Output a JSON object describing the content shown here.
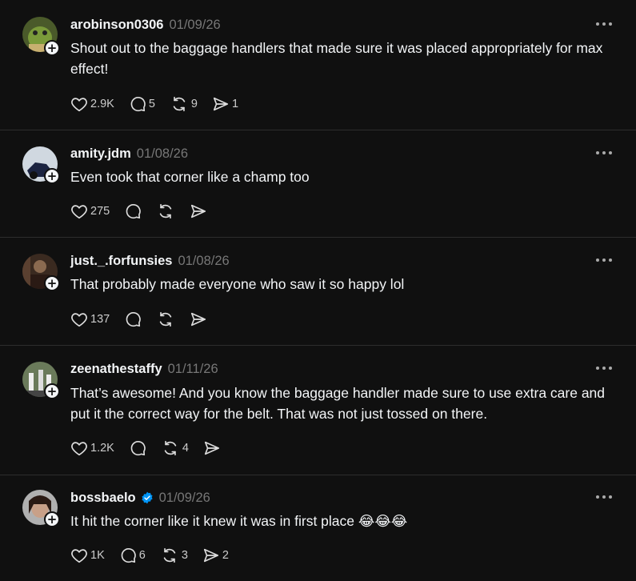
{
  "posts": [
    {
      "username": "arobinson0306",
      "date": "01/09/26",
      "verified": false,
      "text": "Shout out to the baggage handlers that made sure it was placed appropriately for max effect!",
      "likes": "2.9K",
      "replies": "5",
      "reposts": "9",
      "shares": "1"
    },
    {
      "username": "amity.jdm",
      "date": "01/08/26",
      "verified": false,
      "text": "Even took that corner like a champ too",
      "likes": "275",
      "replies": "",
      "reposts": "",
      "shares": ""
    },
    {
      "username": "just._.forfunsies",
      "date": "01/08/26",
      "verified": false,
      "text": "That probably made everyone who saw it so happy lol",
      "likes": "137",
      "replies": "",
      "reposts": "",
      "shares": ""
    },
    {
      "username": "zeenathestaffy",
      "date": "01/11/26",
      "verified": false,
      "text": "That’s awesome! And you know the baggage handler made sure to use extra care and put it the correct way for the belt. That was not just tossed on there.",
      "likes": "1.2K",
      "replies": "",
      "reposts": "4",
      "shares": ""
    },
    {
      "username": "bossbaelo",
      "date": "01/09/26",
      "verified": true,
      "text": "It hit the corner like it knew it was in first place",
      "emoji": "😂😂😂",
      "likes": "1K",
      "replies": "6",
      "reposts": "3",
      "shares": "2"
    }
  ],
  "icons": {
    "like": "heart-icon",
    "reply": "comment-icon",
    "repost": "repost-icon",
    "share": "send-icon",
    "more": "more-options-icon",
    "follow": "plus-icon",
    "verified": "verified-badge-icon"
  },
  "colors": {
    "background": "#101010",
    "text": "#f3f5f7",
    "muted": "#777777",
    "divider": "#2d2d2d",
    "verified": "#0095f6"
  }
}
